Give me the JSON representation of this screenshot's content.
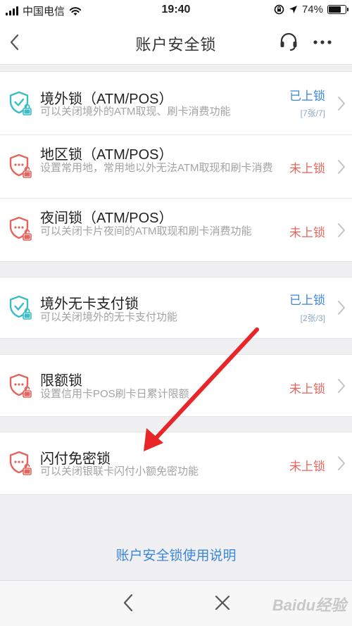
{
  "status_bar": {
    "carrier": "中国电信",
    "time": "19:40",
    "battery": "74%",
    "battery_level": 0.74
  },
  "nav": {
    "title": "账户安全锁"
  },
  "locks": [
    {
      "title": "境外锁（ATM/POS）",
      "desc": "可以关闭境外的ATM取现、刷卡消费功能",
      "status": "已上锁",
      "state": "on",
      "count": "[7张/7]",
      "icon_color": "#3cbcc4"
    },
    {
      "title": "地区锁（ATM/POS）",
      "desc": "设置常用地，常用地以外无法ATM取现和刷卡消费",
      "status": "未上锁",
      "state": "off",
      "icon_color": "#e2665e"
    },
    {
      "title": "夜间锁（ATM/POS）",
      "desc": "可以关闭卡片夜间的ATM取现和刷卡消费功能",
      "status": "未上锁",
      "state": "off",
      "icon_color": "#e2665e"
    },
    {
      "title": "境外无卡支付锁",
      "desc": "可以关闭境外的无卡支付功能",
      "status": "已上锁",
      "state": "on",
      "count": "[2张/3]",
      "icon_color": "#3cbcc4"
    },
    {
      "title": "限额锁",
      "desc": "设置信用卡POS刷卡日累计限额",
      "status": "未上锁",
      "state": "off",
      "icon_color": "#e2665e"
    },
    {
      "title": "闪付免密锁",
      "desc": "可以关闭银联卡闪付小额免密功能",
      "status": "未上锁",
      "state": "off",
      "icon_color": "#e2665e"
    }
  ],
  "footer_link": "账户安全锁使用说明",
  "colors": {
    "accent_blue": "#3b86d8",
    "locked_teal": "#3cbcc4",
    "unlocked_red": "#e2665e",
    "annotation_arrow": "#e8262a"
  },
  "watermark": "Baidu经验"
}
